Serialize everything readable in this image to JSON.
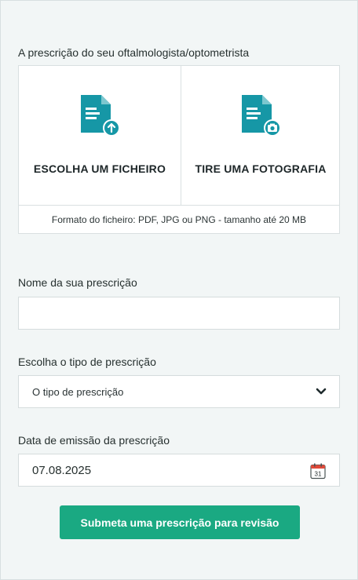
{
  "prescription_upload": {
    "section_label": "A prescrição do seu oftalmologista/optometrista",
    "choose_file_label": "ESCOLHA UM FICHEIRO",
    "take_photo_label": "TIRE UMA FOTOGRAFIA",
    "format_hint": "Formato do ficheiro: PDF, JPG ou PNG - tamanho até 20 MB",
    "choose_file_icon": "document-upload-icon",
    "take_photo_icon": "document-camera-icon"
  },
  "name_field": {
    "label": "Nome da sua prescrição",
    "value": "",
    "placeholder": ""
  },
  "type_field": {
    "label": "Escolha o tipo de prescrição",
    "selected": "O tipo de prescrição",
    "icon": "chevron-down-icon"
  },
  "date_field": {
    "label": "Data de emissão da prescrição",
    "value": "07.08.2025",
    "icon": "calendar-icon",
    "calendar_day": "31"
  },
  "submit": {
    "label": "Submeta uma prescrição para revisão"
  },
  "colors": {
    "icon_teal": "#1697a6",
    "button_green": "#1aa982",
    "background": "#f2f6f6"
  }
}
